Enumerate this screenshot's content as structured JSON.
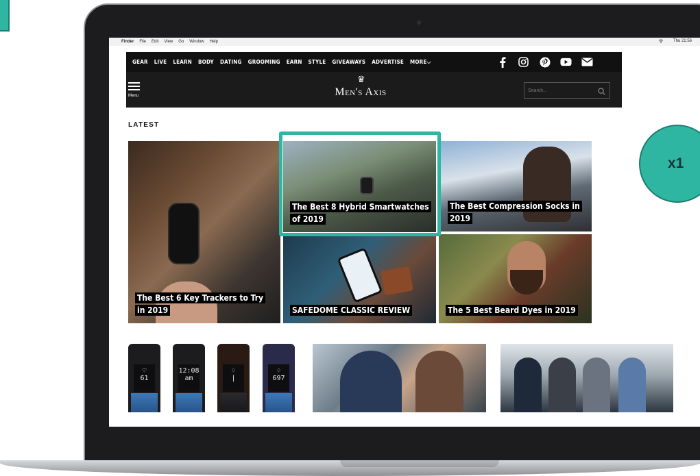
{
  "menubar": {
    "apple": "",
    "items": [
      "Finder",
      "File",
      "Edit",
      "View",
      "Go",
      "Window",
      "Help"
    ],
    "clock": "Thu 21:56"
  },
  "nav": {
    "items": [
      "GEAR",
      "LIVE",
      "LEARN",
      "BODY",
      "DATING",
      "GROOMING",
      "EARN",
      "STYLE",
      "GIVEAWAYS",
      "ADVERTISE",
      "MORE⌵"
    ],
    "social": [
      "facebook-icon",
      "instagram-icon",
      "pinterest-icon",
      "youtube-icon",
      "email-icon"
    ]
  },
  "header": {
    "menu_label": "Menu",
    "logo": "Men's Axis",
    "search_placeholder": "Search..."
  },
  "section": {
    "title": "LATEST"
  },
  "articles": [
    {
      "title": "The Best 6 Key Trackers to Try in 2019"
    },
    {
      "title": "The Best 8 Hybrid Smartwatches of 2019"
    },
    {
      "title": "The Best Compression Socks in 2019"
    },
    {
      "title": "SAFEDOME CLASSIC REVIEW"
    },
    {
      "title": "The 5 Best Beard Dyes in 2019"
    }
  ],
  "bands": [
    {
      "line1": "♡",
      "line2": "61"
    },
    {
      "line1": "12:08",
      "line2": "am"
    },
    {
      "line1": "♢",
      "line2": "|"
    },
    {
      "line1": "♢",
      "line2": "697"
    }
  ],
  "annotation": {
    "badge": "x1"
  },
  "colors": {
    "accent": "#2fb6a2",
    "nav_bg": "#111111"
  }
}
